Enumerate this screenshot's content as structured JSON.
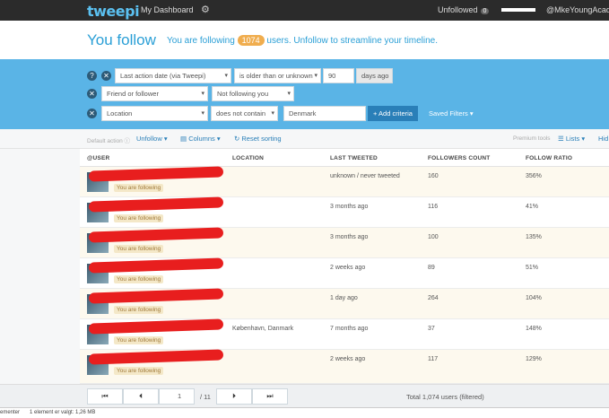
{
  "nav": {
    "logo": "tweepi",
    "dashboard_label": "My Dashboard",
    "unfollowed_label": "Unfollowed",
    "unfollowed_count": "0",
    "username": "@MkeYoungAcader"
  },
  "header": {
    "title": "You follow",
    "subtitle_prefix": "You are following",
    "count": "1074",
    "subtitle_suffix": "users. Unfollow to streamline your timeline."
  },
  "filters": {
    "row1": {
      "field": "Last action date (via Tweepi)",
      "operator": "is older than or unknown",
      "value": "90",
      "unit": "days ago"
    },
    "row2": {
      "field": "Friend or follower",
      "operator": "Not following you"
    },
    "row3": {
      "field": "Location",
      "operator": "does not contain",
      "value": "Denmark"
    },
    "add_label": "+ Add criteria",
    "saved_label": "Saved Filters"
  },
  "toolbar": {
    "default_action": "Default action",
    "unfollow": "Unfollow",
    "columns": "Columns",
    "reset": "Reset sorting",
    "premium": "Premium tools",
    "lists": "Lists",
    "hide": "Hid"
  },
  "table": {
    "headers": [
      "@USER",
      "LOCATION",
      "LAST TWEETED",
      "FOLLOWERS COUNT",
      "FOLLOW RATIO"
    ],
    "following_badge": "You are following",
    "rows": [
      {
        "location": "",
        "last": "unknown / never tweeted",
        "followers": "160",
        "ratio": "356%"
      },
      {
        "location": "",
        "last": "3 months ago",
        "followers": "116",
        "ratio": "41%"
      },
      {
        "location": "",
        "last": "3 months ago",
        "followers": "100",
        "ratio": "135%"
      },
      {
        "location": "",
        "last": "2 weeks ago",
        "followers": "89",
        "ratio": "51%"
      },
      {
        "location": "",
        "last": "1 day ago",
        "followers": "264",
        "ratio": "104%"
      },
      {
        "location": "København, Danmark",
        "last": "7 months ago",
        "followers": "37",
        "ratio": "148%"
      },
      {
        "location": "",
        "last": "2 weeks ago",
        "followers": "117",
        "ratio": "129%"
      }
    ]
  },
  "pager": {
    "first": "⏮",
    "prev": "⏴",
    "page": "1",
    "of": "/ 11",
    "next": "⏵",
    "last": "⏭",
    "total": "Total 1,074 users (filtered)"
  },
  "status": {
    "left": "ementer",
    "selected": "1 element er valgt: 1,26 MB"
  }
}
